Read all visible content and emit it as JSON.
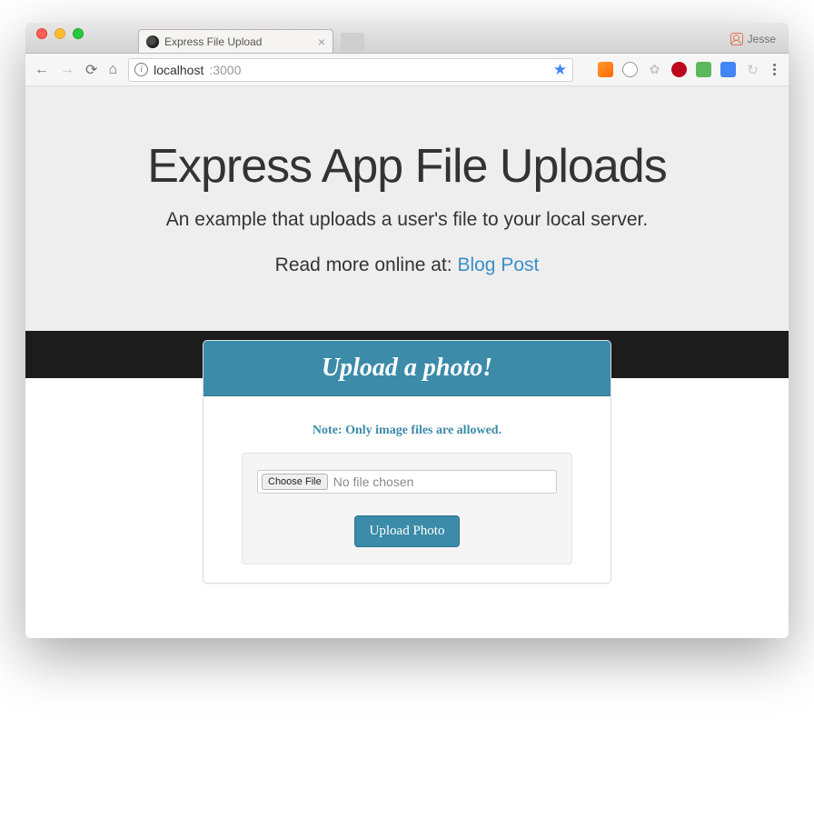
{
  "browser": {
    "tab_title": "Express File Upload",
    "user_name": "Jesse",
    "url_host": "localhost",
    "url_port": ":3000"
  },
  "hero": {
    "title": "Express App File Uploads",
    "subtitle": "An example that uploads a user's file to your local server.",
    "read_prefix": "Read more online at: ",
    "read_link": "Blog Post"
  },
  "card": {
    "heading": "Upload a photo!",
    "note": "Note: Only image files are allowed.",
    "choose_label": "Choose File",
    "no_file_text": "No file chosen",
    "upload_label": "Upload Photo"
  }
}
